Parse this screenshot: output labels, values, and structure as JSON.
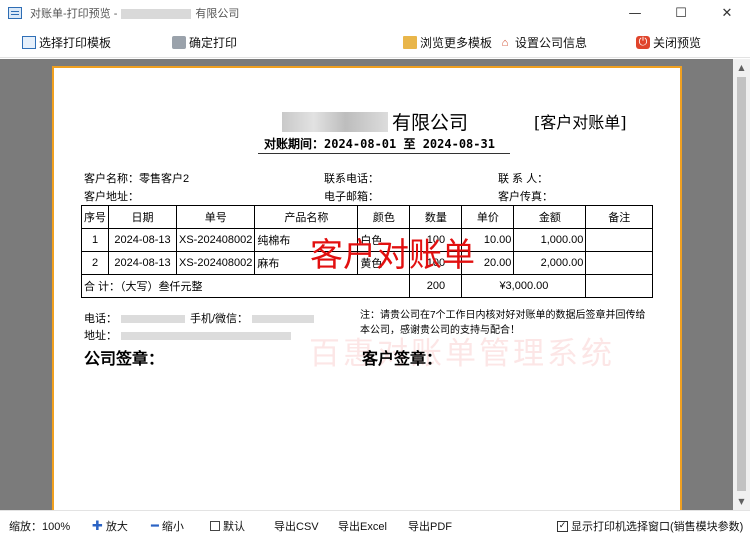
{
  "window": {
    "title_prefix": "对账单-打印预览 -",
    "title_suffix": "有限公司",
    "controls": {
      "minimize": "—",
      "maximize": "☐",
      "close": "✕"
    }
  },
  "toolbar": {
    "select_template": "选择打印模板",
    "confirm_print": "确定打印",
    "browse_templates": "浏览更多模板",
    "company_info": "设置公司信息",
    "close_preview": "关闭预览"
  },
  "document": {
    "company_suffix": "有限公司",
    "doc_type": "[客户对账单]",
    "period": "对账期间：2024-08-01 至 2024-08-31",
    "customer_name_label": "客户名称：",
    "customer_name": "零售客户2",
    "phone_label": "联系电话：",
    "contact_label": "联 系 人：",
    "address_label": "客户地址：",
    "email_label": "电子邮箱：",
    "fax_label": "客户传真：",
    "table": {
      "headers": [
        "序号",
        "日期",
        "单号",
        "产品名称",
        "颜色",
        "数量",
        "单价",
        "金额",
        "备注"
      ],
      "rows": [
        {
          "no": "1",
          "date": "2024-08-13",
          "order": "XS-202408002",
          "product": "纯棉布",
          "color": "白色",
          "qty": "100",
          "price": "10.00",
          "amount": "1,000.00",
          "remark": ""
        },
        {
          "no": "2",
          "date": "2024-08-13",
          "order": "XS-202408002",
          "product": "麻布",
          "color": "黄色",
          "qty": "100",
          "price": "20.00",
          "amount": "2,000.00",
          "remark": ""
        }
      ],
      "total_label": "合 计：（大写）叁仟元整",
      "total_qty": "200",
      "total_amount": "¥3,000.00"
    },
    "overlay_watermark": "客户对账单",
    "bg_watermark": "百惠对账单管理系统",
    "footer_phone_label": "电话：",
    "footer_mobile_label": "手机/微信：",
    "footer_address_label": "地址：",
    "note": "注：请贵公司在7个工作日内核对好对账单的数据后签章并回传给本公司，感谢贵公司的支持与配合！",
    "company_sign": "公司签章：",
    "customer_sign": "客户签章："
  },
  "statusbar": {
    "zoom": "缩放：100%",
    "zoom_in": "放大",
    "zoom_out": "缩小",
    "default": "默认",
    "export_csv": "导出CSV",
    "export_excel": "导出Excel",
    "export_pdf": "导出PDF",
    "show_printer_dialog": "显示打印机选择窗口(销售模块参数)",
    "show_printer_dialog_checked": true
  }
}
